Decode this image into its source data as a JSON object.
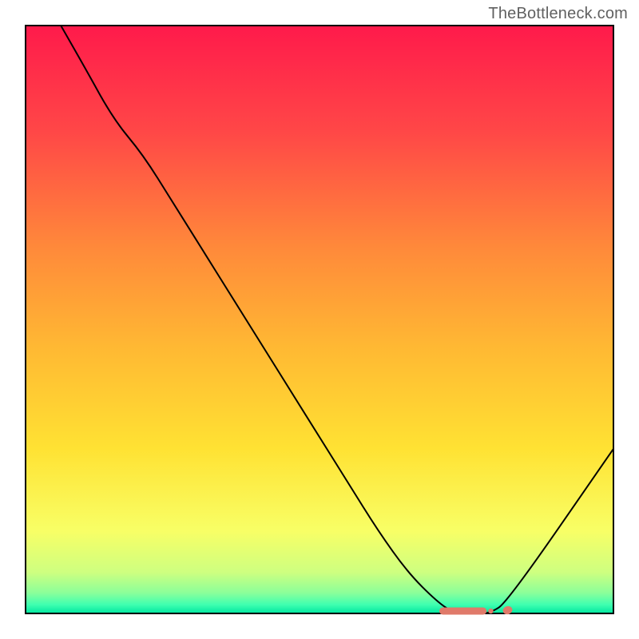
{
  "watermark": "TheBottleneck.com",
  "chart_data": {
    "type": "line",
    "title": "",
    "xlabel": "",
    "ylabel": "",
    "xlim": [
      0,
      100
    ],
    "ylim": [
      0,
      100
    ],
    "x": [
      6,
      10,
      15,
      20,
      25,
      30,
      35,
      40,
      45,
      50,
      55,
      60,
      65,
      70,
      73,
      76,
      79,
      82,
      100
    ],
    "values": [
      100,
      93,
      84,
      78,
      70,
      62,
      54,
      46,
      38,
      30,
      22,
      14,
      7,
      2,
      0,
      0,
      0,
      2,
      28
    ],
    "series_name": "bottleneck-curve",
    "flat_region": {
      "x_start": 71,
      "x_end": 82,
      "marker_color": "#e07a6a"
    },
    "gradient_stops": [
      {
        "offset": 0.0,
        "color": "#ff1a4b"
      },
      {
        "offset": 0.18,
        "color": "#ff4747"
      },
      {
        "offset": 0.38,
        "color": "#ff8a3a"
      },
      {
        "offset": 0.55,
        "color": "#ffb933"
      },
      {
        "offset": 0.72,
        "color": "#ffe233"
      },
      {
        "offset": 0.86,
        "color": "#f8ff66"
      },
      {
        "offset": 0.93,
        "color": "#ceff80"
      },
      {
        "offset": 0.965,
        "color": "#8bff9a"
      },
      {
        "offset": 0.985,
        "color": "#3fffb0"
      },
      {
        "offset": 1.0,
        "color": "#00e6a0"
      }
    ],
    "frame_color": "#000000",
    "line_color": "#000000",
    "line_width": 2
  }
}
